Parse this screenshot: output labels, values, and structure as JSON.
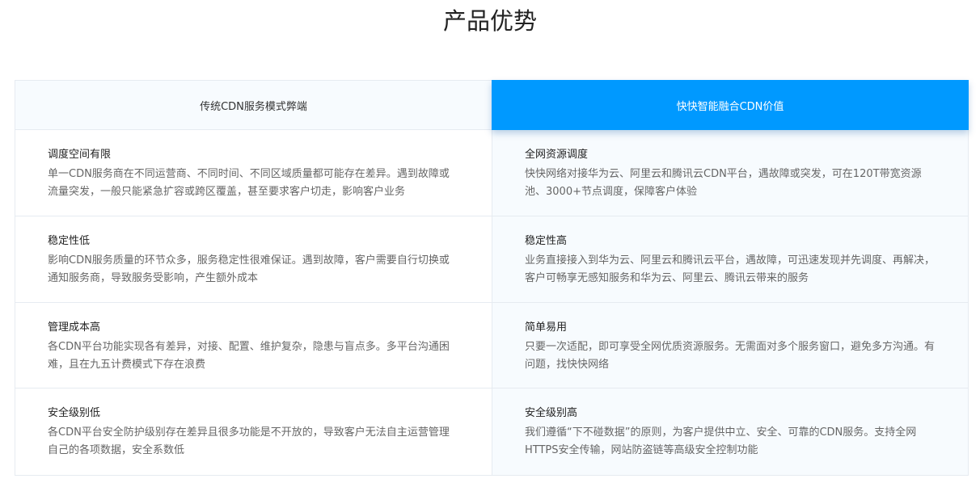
{
  "section": {
    "title": "产品优势"
  },
  "traditional": {
    "header": "传统CDN服务模式弊端",
    "items": [
      {
        "title": "调度空间有限",
        "desc": "单一CDN服务商在不同运营商、不同时间、不同区域质量都可能存在差异。遇到故障或流量突发，一般只能紧急扩容或跨区覆盖，甚至要求客户切走，影响客户业务"
      },
      {
        "title": "稳定性低",
        "desc": "影响CDN服务质量的环节众多，服务稳定性很难保证。遇到故障，客户需要自行切换或通知服务商，导致服务受影响，产生额外成本"
      },
      {
        "title": "管理成本高",
        "desc": "各CDN平台功能实现各有差异，对接、配置、维护复杂，隐患与盲点多。多平台沟通困难，且在九五计费模式下存在浪费"
      },
      {
        "title": "安全级别低",
        "desc": "各CDN平台安全防护级别存在差异且很多功能是不开放的，导致客户无法自主运营管理自己的各项数据，安全系数低"
      }
    ]
  },
  "fusion": {
    "header": "快快智能融合CDN价值",
    "items": [
      {
        "title": "全网资源调度",
        "desc": "快快网络对接华为云、阿里云和腾讯云CDN平台，遇故障或突发，可在120T带宽资源池、3000+节点调度，保障客户体验"
      },
      {
        "title": "稳定性高",
        "desc": "业务直接接入到华为云、阿里云和腾讯云平台，遇故障，可迅速发现并先调度、再解决，客户可畅享无感知服务和华为云、阿里云、腾讯云带来的服务"
      },
      {
        "title": "简单易用",
        "desc": "只要一次适配，即可享受全网优质资源服务。无需面对多个服务窗口，避免多方沟通。有问题，找快快网络"
      },
      {
        "title": "安全级别高",
        "desc": "我们遵循“下不碰数据”的原则，为客户提供中立、安全、可靠的CDN服务。支持全网HTTPS安全传输，网站防盗链等高级安全控制功能"
      }
    ]
  },
  "colors": {
    "accent": "#0099ff",
    "border": "#e6ebf1",
    "light_bg": "#f7fbfe"
  }
}
